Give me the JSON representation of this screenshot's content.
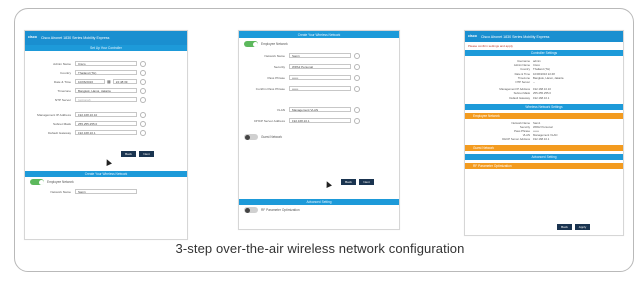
{
  "caption": "3-step over-the-air wireless network configuration",
  "header": {
    "logo": "cisco",
    "title": "Cisco Aironet 1830 Series Mobility Express"
  },
  "step1": {
    "section_title": "Set Up Your Controller",
    "fields": [
      {
        "label": "Admin Name",
        "value": "Cisco"
      },
      {
        "label": "Country",
        "value": "Thailand (TH)"
      },
      {
        "label": "Date & Time",
        "value": "10/06/2016",
        "extra": "22:48:39"
      },
      {
        "label": "Timezone",
        "value": "Bangkok, Hanoi, Jakarta"
      },
      {
        "label": "NTP Server",
        "value": "(optional)"
      },
      {
        "label": "Management IP Address",
        "value": "192.168.10.10"
      },
      {
        "label": "Subnet Mask",
        "value": "255.255.255.0"
      },
      {
        "label": "Default Gateway",
        "value": "192.168.10.1"
      }
    ],
    "buttons": {
      "back": "Back",
      "next": "Next"
    },
    "lower_section": "Create Your Wireless Network",
    "toggle_label": "Employee Network",
    "last_field": {
      "label": "Network Name",
      "value": "Sam1"
    }
  },
  "step2": {
    "section_title": "Create Your Wireless Network",
    "toggle_label": "Employee Network",
    "fields": [
      {
        "label": "Network Name",
        "value": "Sam1"
      },
      {
        "label": "Security",
        "value": "WPA2 Personal"
      },
      {
        "label": "Pass Phrase",
        "value": "••••••"
      },
      {
        "label": "Confirm Pass Phrase",
        "value": "••••••"
      },
      {
        "label": "VLAN",
        "value": "Management VLAN"
      },
      {
        "label": "DHCP Server Address",
        "value": "192.168.10.1"
      }
    ],
    "guest_label": "Guest Network",
    "buttons": {
      "back": "Back",
      "next": "Next"
    },
    "lower_section": "Advanced Setting",
    "rf_label": "RF Parameter Optimization"
  },
  "step3": {
    "note": "Please confirm settings and apply",
    "controller_title": "Controller Settings",
    "controller_rows": [
      {
        "k": "Username",
        "v": "admin"
      },
      {
        "k": "Admin Name",
        "v": "Cisco"
      },
      {
        "k": "Country",
        "v": "Thailand (TH)"
      },
      {
        "k": "Date & Time",
        "v": "10/06/2016 22:48"
      },
      {
        "k": "Timezone",
        "v": "Bangkok, Hanoi, Jakarta"
      },
      {
        "k": "NTP Server",
        "v": "--"
      },
      {
        "k": "Management IP Address",
        "v": "192.168.10.10"
      },
      {
        "k": "Subnet Mask",
        "v": "255.255.255.0"
      },
      {
        "k": "Default Gateway",
        "v": "192.168.10.1"
      }
    ],
    "wireless_title": "Wireless Network Settings",
    "employee_label": "Employee Network",
    "wireless_rows": [
      {
        "k": "Network Name",
        "v": "Sam1"
      },
      {
        "k": "Security",
        "v": "WPA2 Personal"
      },
      {
        "k": "Pass Phrase",
        "v": "••••••"
      },
      {
        "k": "VLAN",
        "v": "Management VLAN"
      },
      {
        "k": "DHCP Server Address",
        "v": "192.168.10.1"
      }
    ],
    "guest_label": "Guest Network",
    "advanced_title": "Advanced Setting",
    "rf_label": "RF Parameter Optimization",
    "buttons": {
      "back": "Back",
      "apply": "Apply"
    }
  }
}
